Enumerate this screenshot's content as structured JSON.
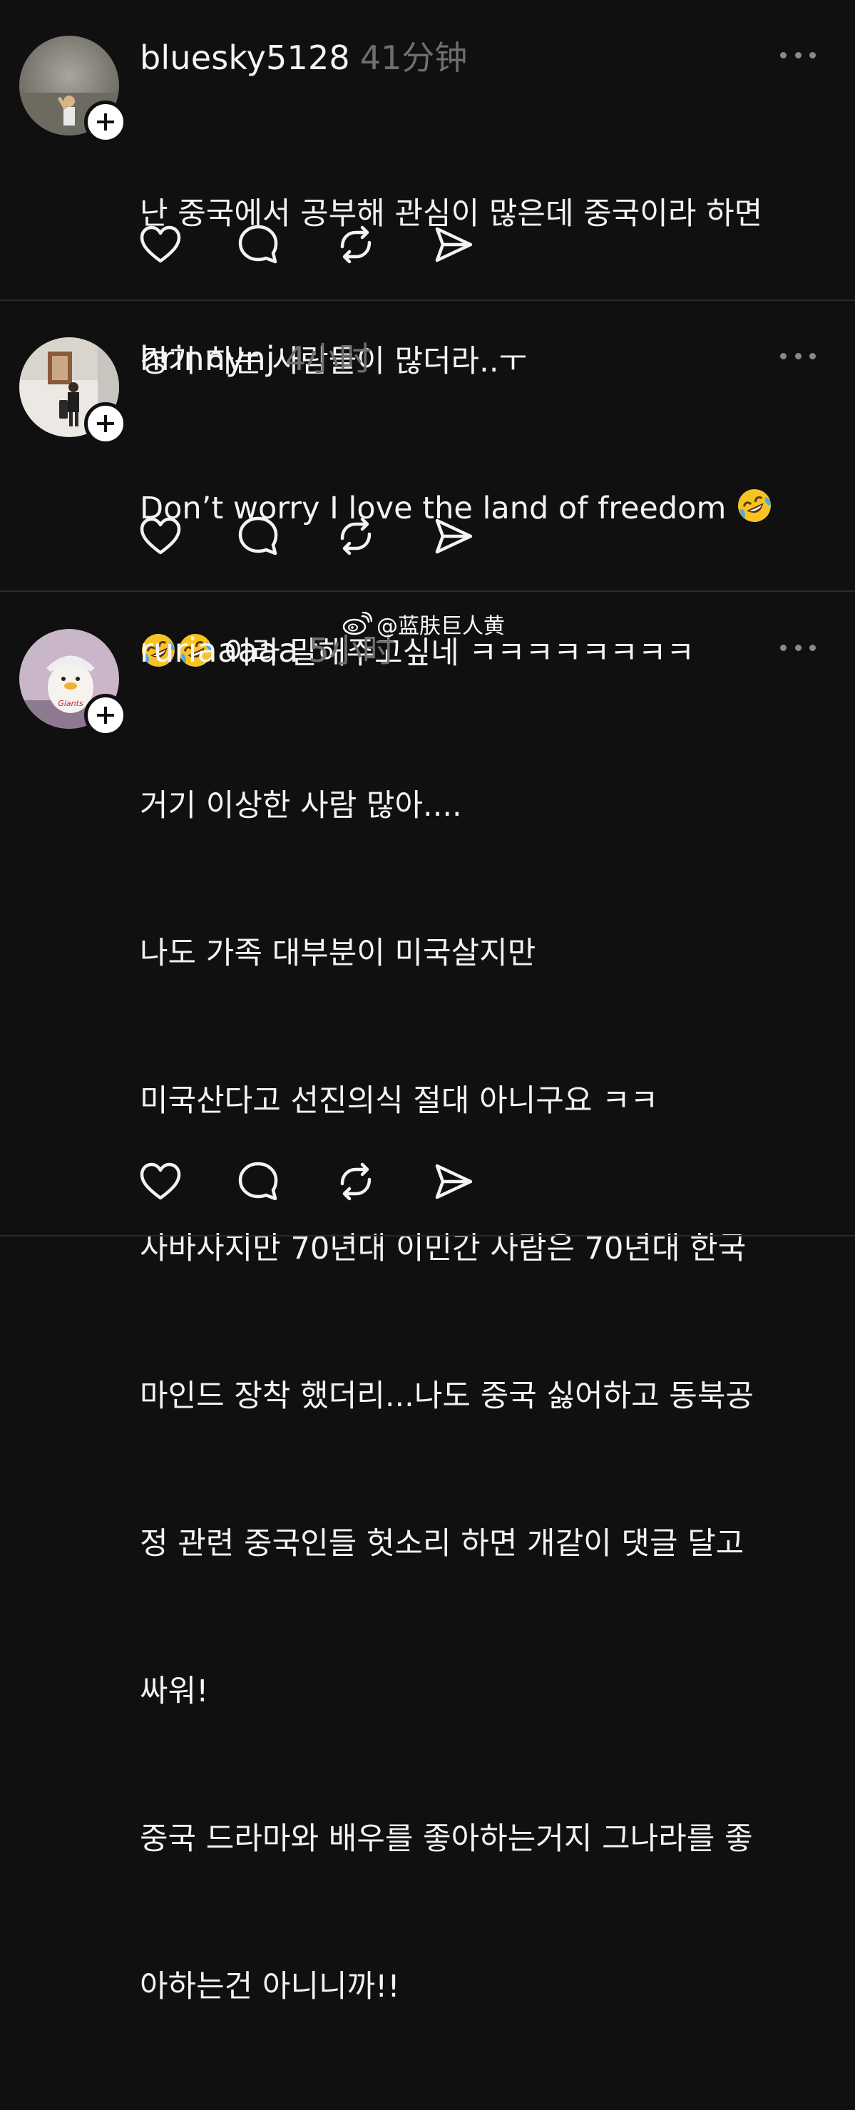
{
  "posts": [
    {
      "username": "bluesky5128",
      "time": "41分钟",
      "lines": [
        "난 중국에서 공부해 관심이 많은데 중국이라 하면",
        "경기 하는 사람들이 많더라..ㅜ"
      ]
    },
    {
      "username": "hrinnynj",
      "time": "4小时",
      "line1_text": "Don’t worry I love the land of freedom ",
      "line2_text": " 이라 말해주고싶네 ㅋㅋㅋㅋㅋㅋㅋㅋ"
    },
    {
      "username": "ruriaaaaa",
      "time": "5小时",
      "lines": [
        "거기 이상한 사람 많아....",
        "나도 가족 대부분이 미국살지만",
        "미국산다고 선진의식 절대 아니구요 ㅋㅋ",
        "사바사지만 70년대 이민간 사람은 70년대 한국",
        "마인드 장착 했더리...나도 중국 싫어하고 동북공",
        "정 관련 중국인들 헛소리 하면 개같이 댓글 달고",
        "싸워!",
        "중국 드라마와 배우를 좋아하는거지 그나라를 좋",
        "아하는건 아니니까!!"
      ]
    }
  ],
  "icons": {
    "like": "heart-icon",
    "reply": "comment-icon",
    "repost": "repost-icon",
    "share": "send-icon",
    "more": "more-dots-icon",
    "follow": "plus-icon",
    "emoji": "rolling-laughing-emoji"
  },
  "watermark": {
    "text": "@蓝肤巨人黄",
    "icon": "weibo-icon"
  },
  "colors": {
    "background": "#101010",
    "text": "#f3f3f3",
    "muted": "#6f6f6f",
    "divider": "#2a2a2a"
  }
}
